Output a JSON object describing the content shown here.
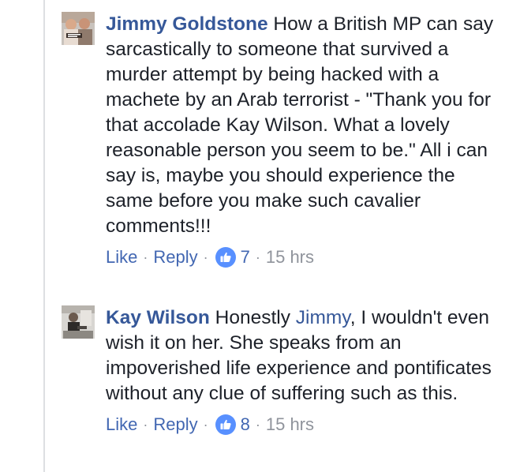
{
  "comments": [
    {
      "author": "Jimmy Goldstone",
      "text": "How a British MP can say sarcastically to someone that survived a murder attempt by being hacked with a machete by an Arab terrorist - \"Thank you for that accolade Kay Wilson. What a lovely reasonable person you seem to be.\" All i can say is, maybe you should experience the same before you make such cavalier comments!!!",
      "like_label": "Like",
      "reply_label": "Reply",
      "reaction_count": "7",
      "time": "15 hrs"
    },
    {
      "author": "Kay Wilson",
      "text_before": "Honestly ",
      "mention": "Jimmy",
      "text_after": ", I wouldn't even wish it on her. She speaks from an impoverished life experience and pontificates without any clue of suffering such as this.",
      "like_label": "Like",
      "reply_label": "Reply",
      "reaction_count": "8",
      "time": "15 hrs"
    }
  ],
  "separator": "·",
  "icons": {
    "reaction": "thumbs-up-icon",
    "avatar1": "user-avatar-photo",
    "avatar2": "user-avatar-photo"
  },
  "colors": {
    "author": "#365899",
    "link": "#4267b2",
    "text": "#1d2129",
    "meta": "#90949c",
    "like_badge": "#5890ff"
  }
}
